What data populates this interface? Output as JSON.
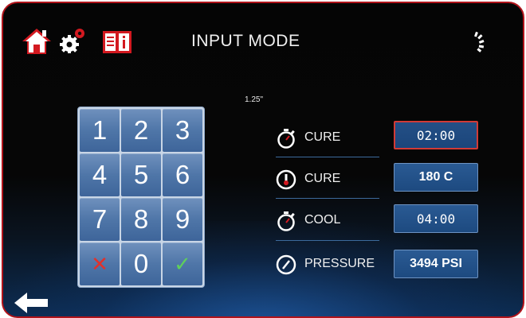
{
  "header": {
    "title": "INPUT MODE",
    "icons": [
      "home-icon",
      "gear-icon",
      "manual-icon",
      "brand-logo"
    ]
  },
  "scale_note": "1.25\"",
  "keypad": {
    "keys": [
      "1",
      "2",
      "3",
      "4",
      "5",
      "6",
      "7",
      "8",
      "9",
      "✕",
      "0",
      "✓"
    ]
  },
  "parameters": [
    {
      "icon": "stopwatch-icon",
      "label": "CURE",
      "value": "02:00",
      "active": true
    },
    {
      "icon": "thermometer-icon",
      "label": "CURE",
      "value": "180 C",
      "active": false
    },
    {
      "icon": "stopwatch-icon",
      "label": "COOL",
      "value": "04:00",
      "active": false
    },
    {
      "icon": "gauge-icon",
      "label": "PRESSURE",
      "value": "3494 PSI",
      "active": false
    }
  ],
  "footer": {
    "icon": "back-arrow-icon"
  },
  "colors": {
    "accent_red": "#c9161d",
    "panel_blue": "#2a5a93",
    "key_blue": "#4f76a8",
    "confirm_green": "#5fd05a"
  }
}
